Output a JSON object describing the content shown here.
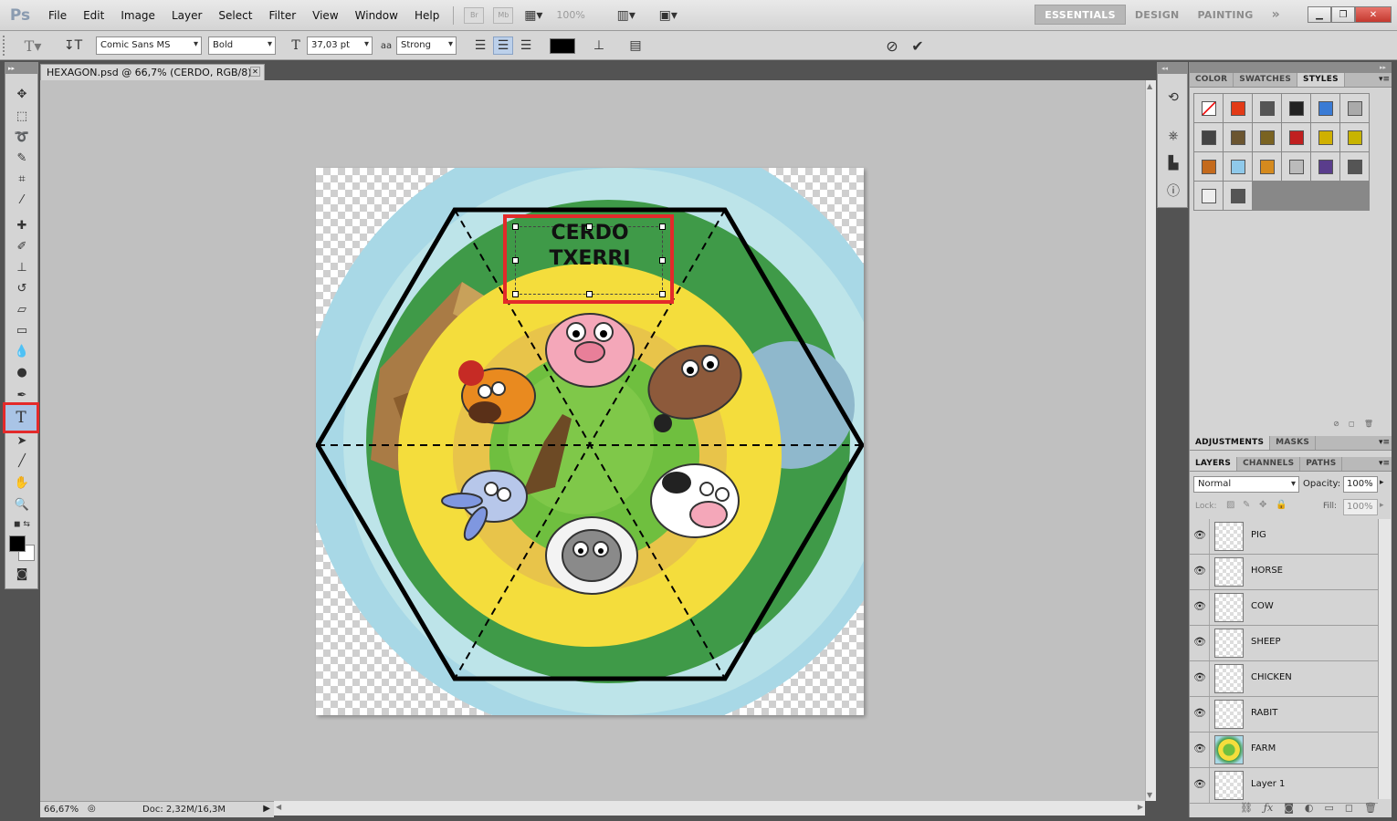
{
  "app": {
    "logo": "Ps"
  },
  "menu": [
    "File",
    "Edit",
    "Image",
    "Layer",
    "Select",
    "Filter",
    "View",
    "Window",
    "Help"
  ],
  "menubar": {
    "bridge_label": "Br",
    "minibridge_label": "Mb",
    "zoom": "100%"
  },
  "workspaces": [
    {
      "label": "ESSENTIALS",
      "active": true
    },
    {
      "label": "DESIGN",
      "active": false
    },
    {
      "label": "PAINTING",
      "active": false
    }
  ],
  "workspaces_more": "»",
  "options": {
    "font_family": "Comic Sans MS",
    "font_style": "Bold",
    "font_size": "37,03 pt",
    "antialias_prefix": "aa",
    "antialias": "Strong"
  },
  "document": {
    "tab_title": "HEXAGON.psd @ 66,7% (CERDO, RGB/8) *",
    "zoom_status": "66,67%",
    "doc_status": "Doc: 2,32M/16,3M",
    "text_line1": "CERDO",
    "text_line2": "TXERRI"
  },
  "colors": {
    "highlight": "#e32a2a",
    "sky": "#a8d8e6",
    "grass_dark": "#3f9a48",
    "grass_light": "#6fbf3f",
    "yellow_ring": "#f4dd3c",
    "straw": "#e8c44a"
  },
  "panels": {
    "top_tabs": [
      {
        "label": "COLOR",
        "active": false
      },
      {
        "label": "SWATCHES",
        "active": false
      },
      {
        "label": "STYLES",
        "active": true
      }
    ],
    "mid_tabs": [
      {
        "label": "ADJUSTMENTS",
        "active": true
      },
      {
        "label": "MASKS",
        "active": false
      }
    ],
    "layer_tabs": [
      {
        "label": "LAYERS",
        "active": true
      },
      {
        "label": "CHANNELS",
        "active": false
      },
      {
        "label": "PATHS",
        "active": false
      }
    ],
    "blend_mode": "Normal",
    "opacity_label": "Opacity:",
    "opacity": "100%",
    "lock_label": "Lock:",
    "fill_label": "Fill:",
    "fill": "100%"
  },
  "styles": [
    "#ffffff",
    "#e23a16",
    "#555555",
    "#222222",
    "#3a7bd5",
    "#aaaaaa",
    "#444444",
    "#6b5530",
    "#7a6322",
    "#c01f1f",
    "#d0b000",
    "#c8b400",
    "#c46a1c",
    "#8fc9ea",
    "#d58a1e",
    "#bbbbbb",
    "#5a3d8c",
    "#555555",
    "#eeeeee",
    "#555555"
  ],
  "layers": [
    {
      "name": "PIG"
    },
    {
      "name": "HORSE"
    },
    {
      "name": "COW"
    },
    {
      "name": "SHEEP"
    },
    {
      "name": "CHICKEN"
    },
    {
      "name": "RABIT"
    },
    {
      "name": "FARM"
    },
    {
      "name": "Layer 1"
    }
  ]
}
